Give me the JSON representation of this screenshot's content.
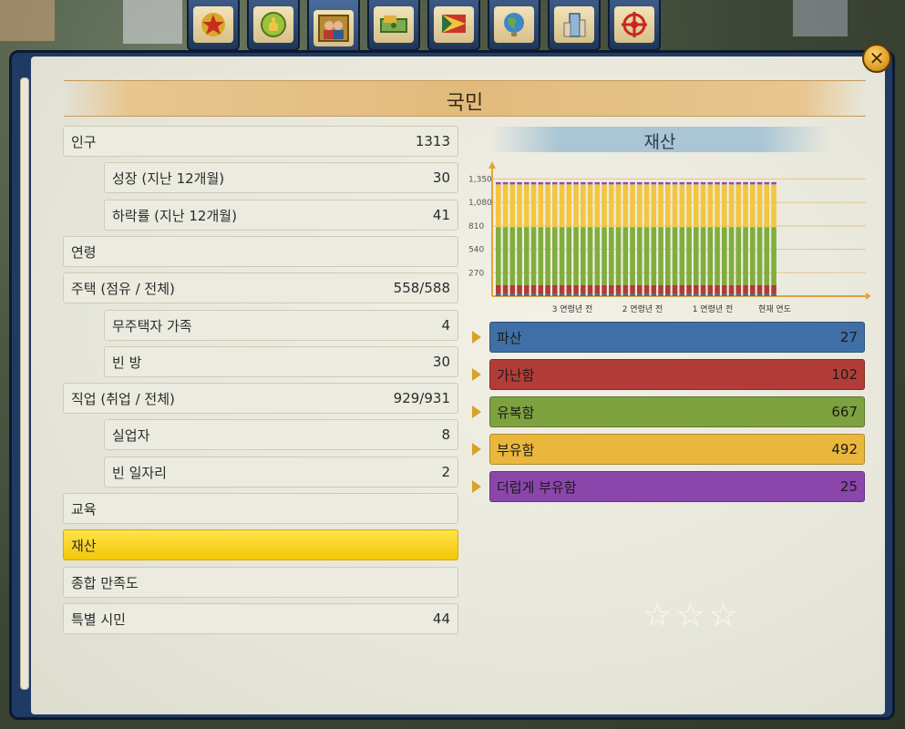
{
  "tabs": [
    {
      "icon": "star-badge-icon",
      "active": false
    },
    {
      "icon": "thumbs-up-icon",
      "active": false
    },
    {
      "icon": "people-portrait-icon",
      "active": true
    },
    {
      "icon": "money-stack-icon",
      "active": false
    },
    {
      "icon": "flag-icon",
      "active": false
    },
    {
      "icon": "globe-icon",
      "active": false
    },
    {
      "icon": "building-icon",
      "active": false
    },
    {
      "icon": "crosshair-icon",
      "active": false
    }
  ],
  "title": "국민",
  "stats": [
    {
      "label": "인구",
      "value": "1313",
      "level": "top"
    },
    {
      "label": "성장 (지난 12개월)",
      "value": "30",
      "level": "sub"
    },
    {
      "label": "하락률 (지난 12개월)",
      "value": "41",
      "level": "sub"
    },
    {
      "label": "연령",
      "value": "",
      "level": "top"
    },
    {
      "label": "주택 (점유 / 전체)",
      "value": "558/588",
      "level": "top"
    },
    {
      "label": "무주택자 가족",
      "value": "4",
      "level": "sub"
    },
    {
      "label": "빈 방",
      "value": "30",
      "level": "sub"
    },
    {
      "label": "직업 (취업 / 전체)",
      "value": "929/931",
      "level": "top"
    },
    {
      "label": "실업자",
      "value": "8",
      "level": "sub"
    },
    {
      "label": "빈 일자리",
      "value": "2",
      "level": "sub"
    },
    {
      "label": "교육",
      "value": "",
      "level": "top"
    },
    {
      "label": "재산",
      "value": "",
      "level": "top",
      "selected": true
    },
    {
      "label": "종합 만족도",
      "value": "",
      "level": "top"
    },
    {
      "label": "특별 시민",
      "value": "44",
      "level": "top"
    }
  ],
  "chart_title": "재산",
  "chart_data": {
    "type": "bar",
    "stacked": true,
    "title": "재산",
    "yticks": [
      "1,350",
      "1,080",
      "810",
      "540",
      "270"
    ],
    "ytick_values": [
      1350,
      1080,
      810,
      540,
      270
    ],
    "ylim": [
      0,
      1470
    ],
    "xticks": [
      "3 연령년 전",
      "2 연령년 전",
      "1 연령년 전",
      "현재 연도"
    ],
    "num_bars": 40,
    "series": [
      {
        "name": "파산",
        "color": "#3e6ea8",
        "value": 27
      },
      {
        "name": "가난함",
        "color": "#b33a35",
        "value": 102
      },
      {
        "name": "유복함",
        "color": "#7fae3e",
        "value": 667
      },
      {
        "name": "부유함",
        "color": "#f2c640",
        "value": 492
      },
      {
        "name": "더럽게 부유함",
        "color": "#8d4bb0",
        "value": 25
      }
    ]
  },
  "legend": [
    {
      "label": "파산",
      "value": "27",
      "color": "#3f6fa6"
    },
    {
      "label": "가난함",
      "value": "102",
      "color": "#b23d38"
    },
    {
      "label": "유복함",
      "value": "667",
      "color": "#7da23f"
    },
    {
      "label": "부유함",
      "value": "492",
      "color": "#eab73d"
    },
    {
      "label": "더럽게 부유함",
      "value": "25",
      "color": "#8a46ab"
    }
  ]
}
